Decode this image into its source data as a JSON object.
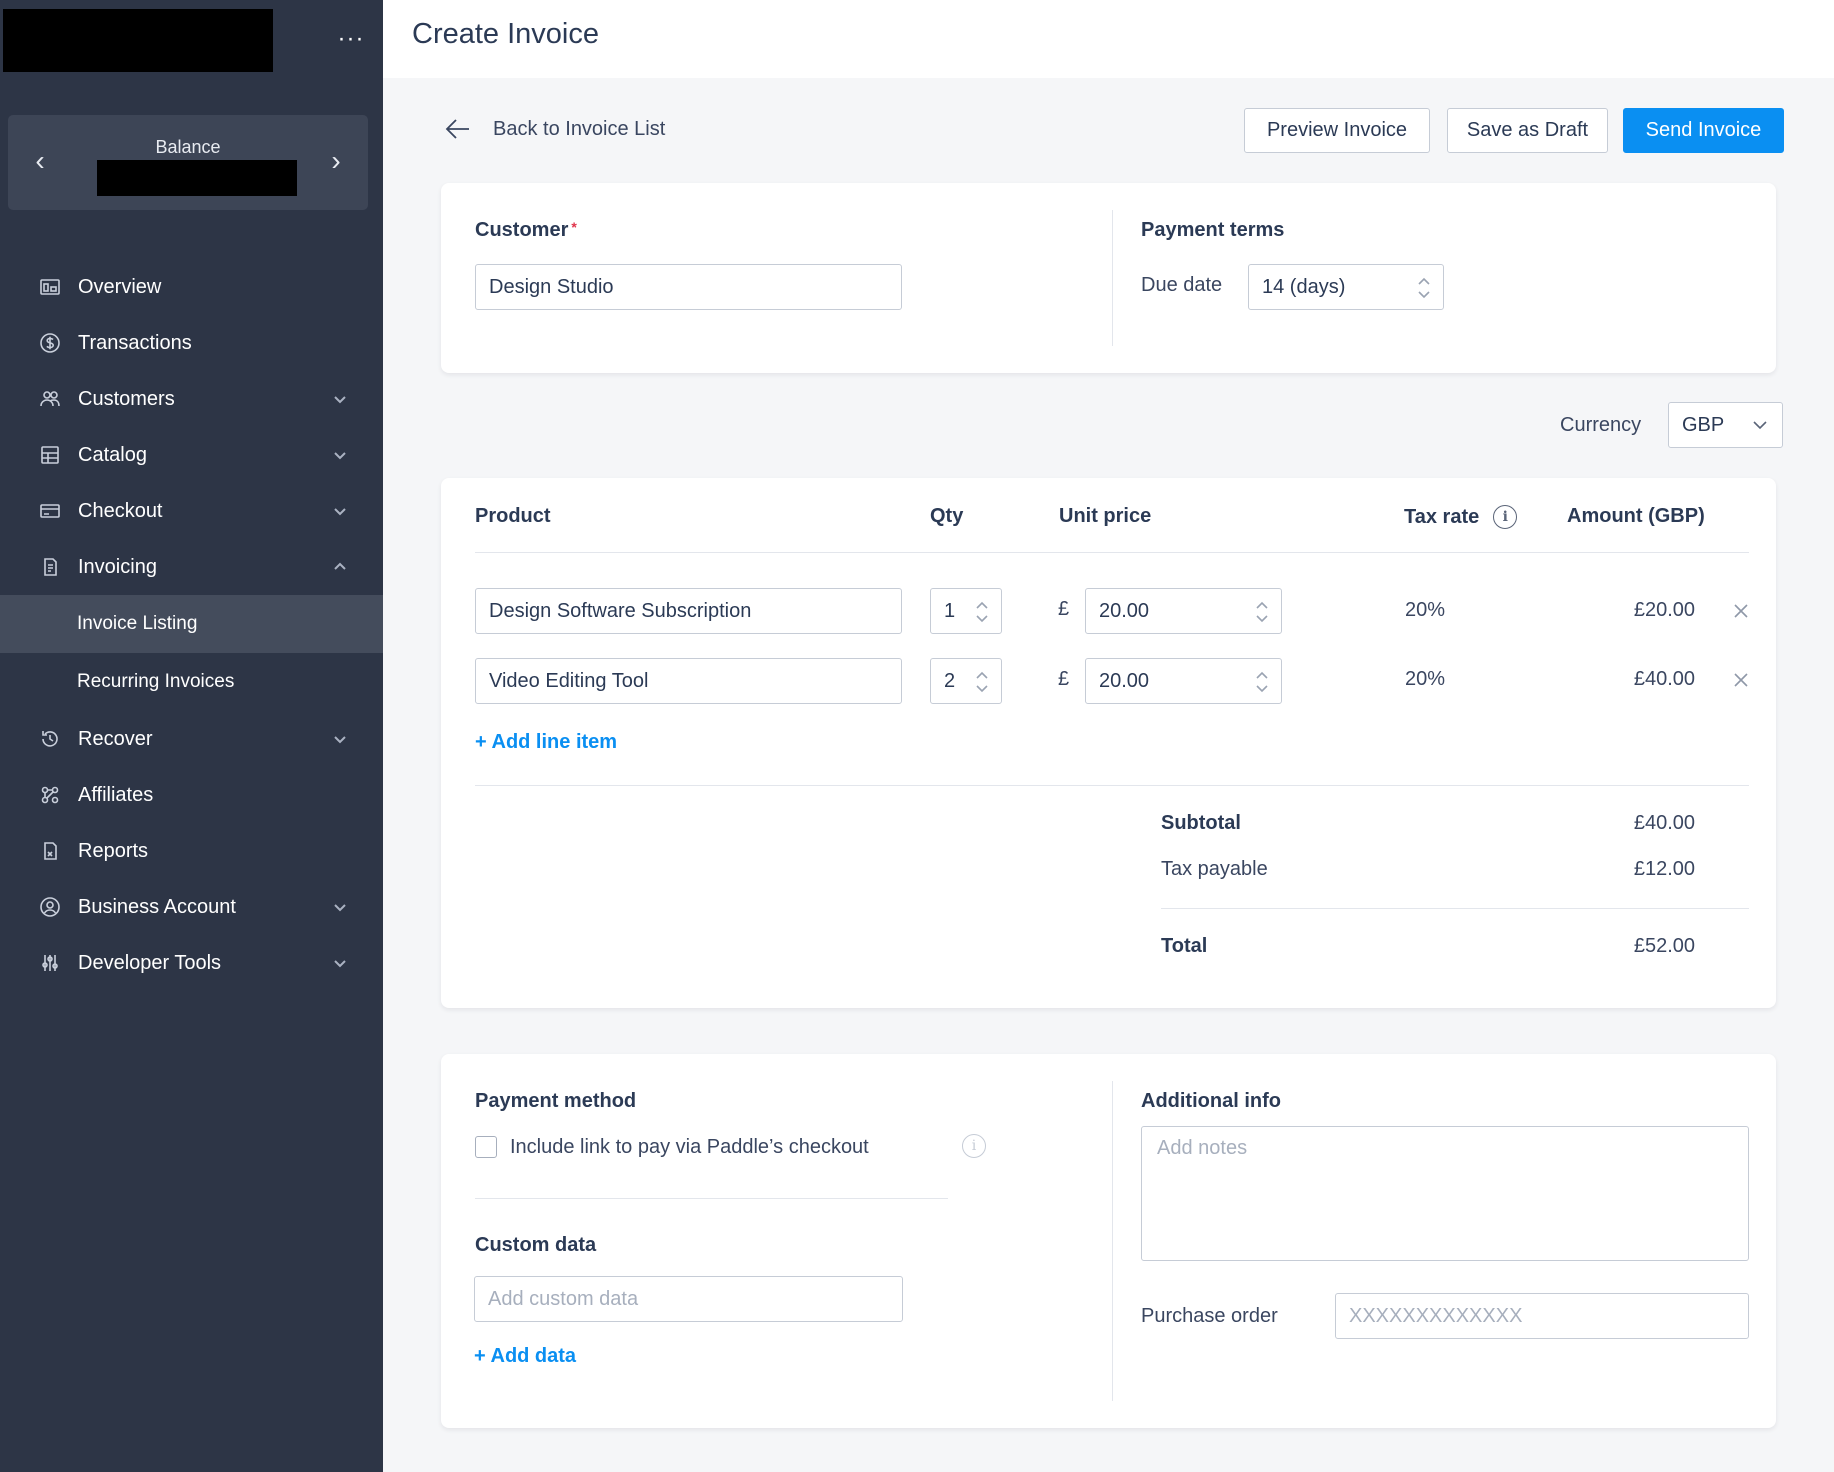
{
  "sidebar": {
    "more_label": "···",
    "balance": {
      "label": "Balance",
      "prev": "‹",
      "next": "›"
    },
    "nav": [
      {
        "label": "Overview",
        "icon": "overview-icon"
      },
      {
        "label": "Transactions",
        "icon": "dollar-circle-icon"
      },
      {
        "label": "Customers",
        "icon": "users-icon",
        "expandable": true
      },
      {
        "label": "Catalog",
        "icon": "catalog-icon",
        "expandable": true
      },
      {
        "label": "Checkout",
        "icon": "credit-card-icon",
        "expandable": true
      },
      {
        "label": "Invoicing",
        "icon": "invoice-icon",
        "expanded": true
      },
      {
        "label": "Recover",
        "icon": "recover-icon",
        "expandable": true
      },
      {
        "label": "Affiliates",
        "icon": "affiliates-icon"
      },
      {
        "label": "Reports",
        "icon": "reports-icon"
      },
      {
        "label": "Business Account",
        "icon": "account-circle-icon",
        "expandable": true
      },
      {
        "label": "Developer Tools",
        "icon": "sliders-icon",
        "expandable": true
      }
    ],
    "invoicing_sub": [
      {
        "label": "Invoice Listing",
        "active": true
      },
      {
        "label": "Recurring Invoices"
      }
    ]
  },
  "header": {
    "title": "Create Invoice"
  },
  "toolbar": {
    "back_label": "Back to Invoice List",
    "preview_label": "Preview Invoice",
    "draft_label": "Save as Draft",
    "send_label": "Send Invoice"
  },
  "customer": {
    "label": "Customer",
    "required_mark": "*",
    "value": "Design Studio"
  },
  "payment_terms": {
    "label": "Payment terms",
    "due_label": "Due date",
    "due_value": "14 (days)"
  },
  "currency": {
    "label": "Currency",
    "value": "GBP"
  },
  "line_items": {
    "headers": {
      "product": "Product",
      "qty": "Qty",
      "unit_price": "Unit price",
      "tax_rate": "Tax rate",
      "amount": "Amount (GBP)"
    },
    "currency_symbol": "£",
    "rows": [
      {
        "product": "Design Software Subscription",
        "qty": "1",
        "unit_price": "20.00",
        "tax": "20%",
        "amount": "£20.00"
      },
      {
        "product": "Video Editing Tool",
        "qty": "2",
        "unit_price": "20.00",
        "tax": "20%",
        "amount": "£40.00"
      }
    ],
    "add_label": "+ Add line item"
  },
  "totals": {
    "subtotal_label": "Subtotal",
    "subtotal_value": "£40.00",
    "tax_label": "Tax payable",
    "tax_value": "£12.00",
    "total_label": "Total",
    "total_value": "£52.00"
  },
  "payment_method": {
    "label": "Payment method",
    "checkbox_label": "Include link to pay via Paddle’s checkout",
    "checked": false
  },
  "custom_data": {
    "label": "Custom data",
    "placeholder": "Add custom data",
    "add_label": "+ Add data"
  },
  "additional_info": {
    "label": "Additional info",
    "notes_placeholder": "Add notes",
    "po_label": "Purchase order",
    "po_placeholder": "XXXXXXXXXXXXX"
  }
}
